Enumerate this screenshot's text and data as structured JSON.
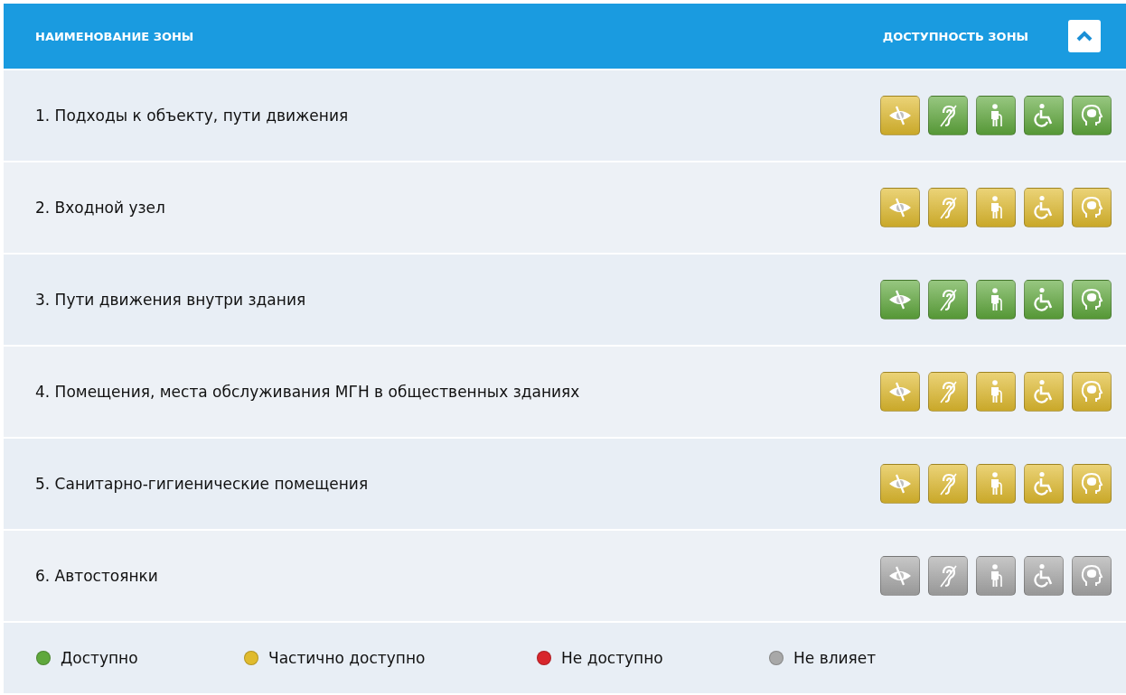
{
  "header": {
    "zone_name_heading": "НАИМЕНОВАНИЕ ЗОНЫ",
    "accessibility_heading": "ДОСТУПНОСТЬ ЗОНЫ",
    "collapse_button": {
      "expanded": true
    }
  },
  "zones": [
    {
      "name": "1. Подходы к объекту, пути движения",
      "icons": [
        {
          "kind": "vision",
          "color": "#e0bb2e"
        },
        {
          "kind": "hearing",
          "color": "#5fa83c"
        },
        {
          "kind": "mobility",
          "color": "#5fa83c"
        },
        {
          "kind": "wheelchair",
          "color": "#5fa83c"
        },
        {
          "kind": "mental",
          "color": "#5fa83c"
        }
      ]
    },
    {
      "name": "2. Входной узел",
      "icons": [
        {
          "kind": "vision",
          "color": "#e0bb2e"
        },
        {
          "kind": "hearing",
          "color": "#e0bb2e"
        },
        {
          "kind": "mobility",
          "color": "#e0bb2e"
        },
        {
          "kind": "wheelchair",
          "color": "#e0bb2e"
        },
        {
          "kind": "mental",
          "color": "#e0bb2e"
        }
      ]
    },
    {
      "name": "3. Пути движения внутри здания",
      "icons": [
        {
          "kind": "vision",
          "color": "#5fa83c"
        },
        {
          "kind": "hearing",
          "color": "#5fa83c"
        },
        {
          "kind": "mobility",
          "color": "#5fa83c"
        },
        {
          "kind": "wheelchair",
          "color": "#5fa83c"
        },
        {
          "kind": "mental",
          "color": "#5fa83c"
        }
      ]
    },
    {
      "name": "4. Помещения, места обслуживания МГН в общественных зданиях",
      "icons": [
        {
          "kind": "vision",
          "color": "#e0bb2e"
        },
        {
          "kind": "hearing",
          "color": "#e0bb2e"
        },
        {
          "kind": "mobility",
          "color": "#e0bb2e"
        },
        {
          "kind": "wheelchair",
          "color": "#e0bb2e"
        },
        {
          "kind": "mental",
          "color": "#e0bb2e"
        }
      ]
    },
    {
      "name": "5. Санитарно-гигиенические помещения",
      "icons": [
        {
          "kind": "vision",
          "color": "#e0bb2e"
        },
        {
          "kind": "hearing",
          "color": "#e0bb2e"
        },
        {
          "kind": "mobility",
          "color": "#e0bb2e"
        },
        {
          "kind": "wheelchair",
          "color": "#e0bb2e"
        },
        {
          "kind": "mental",
          "color": "#e0bb2e"
        }
      ]
    },
    {
      "name": "6. Автостоянки",
      "icons": [
        {
          "kind": "vision",
          "color": "#a8a8a8"
        },
        {
          "kind": "hearing",
          "color": "#a8a8a8"
        },
        {
          "kind": "mobility",
          "color": "#a8a8a8"
        },
        {
          "kind": "wheelchair",
          "color": "#a8a8a8"
        },
        {
          "kind": "mental",
          "color": "#a8a8a8"
        }
      ]
    }
  ],
  "legend": [
    {
      "label": "Доступно",
      "color": "#5fa83c"
    },
    {
      "label": "Частично доступно",
      "color": "#e0bb2e"
    },
    {
      "label": "Не доступно",
      "color": "#d8262c"
    },
    {
      "label": "Не влияет",
      "color": "#a8a8a8"
    }
  ]
}
